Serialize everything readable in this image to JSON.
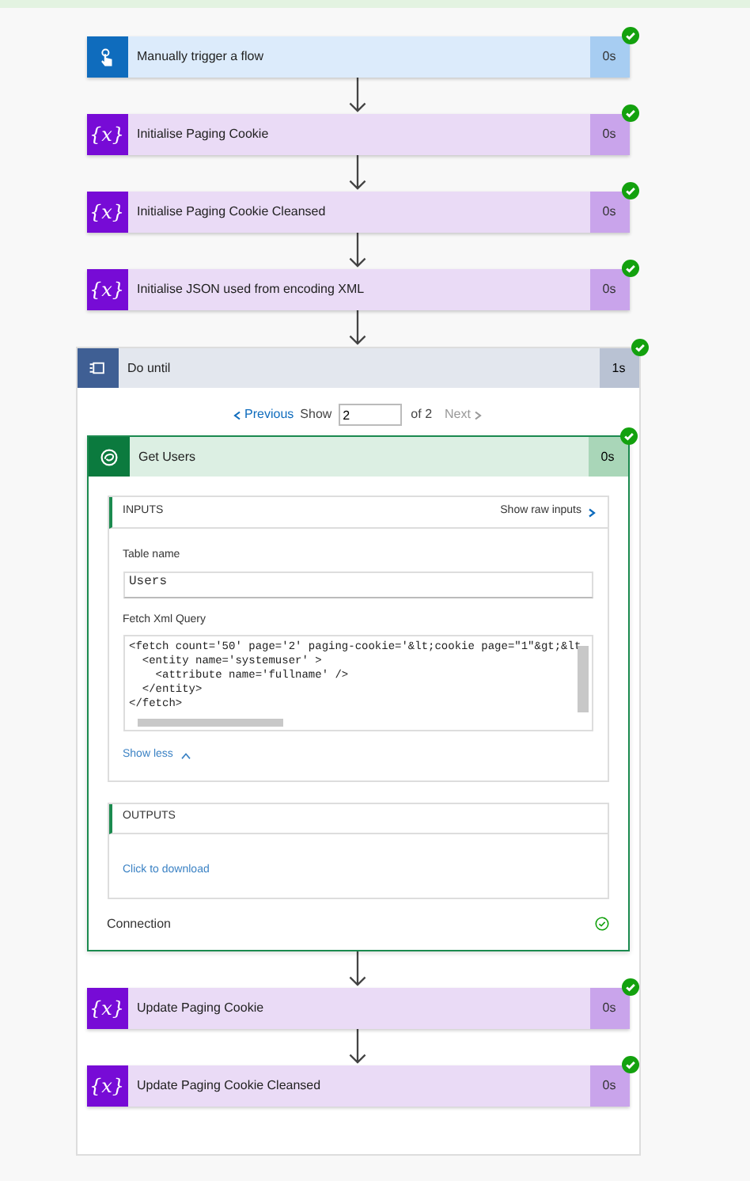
{
  "steps_before": [
    {
      "kind": "trigger",
      "title": "Manually trigger a flow",
      "duration": "0s",
      "succeeded": true
    },
    {
      "kind": "variable",
      "glyph": "{x}",
      "title": "Initialise Paging Cookie",
      "duration": "0s",
      "succeeded": true
    },
    {
      "kind": "variable",
      "glyph": "{x}",
      "title": "Initialise Paging Cookie Cleansed",
      "duration": "0s",
      "succeeded": true
    },
    {
      "kind": "variable",
      "glyph": "{x}",
      "title": "Initialise JSON used from encoding XML",
      "duration": "0s",
      "succeeded": true
    }
  ],
  "loop": {
    "title": "Do until",
    "duration": "1s",
    "succeeded": true,
    "pager": {
      "previous": "Previous",
      "previous_disabled": false,
      "show": "Show",
      "value": "2",
      "of": "of 2",
      "next": "Next",
      "next_disabled": true
    },
    "action": {
      "title": "Get Users",
      "duration": "0s",
      "succeeded": true,
      "inputs": {
        "heading": "INPUTS",
        "raw_link": "Show raw inputs",
        "fields": [
          {
            "label": "Table name",
            "value": "Users"
          }
        ],
        "query": {
          "label": "Fetch Xml Query",
          "lines": [
            "<fetch count='50' page='2' paging-cookie='&lt;cookie page=\"1\"&gt;&lt",
            "  <entity name='systemuser' >",
            "    <attribute name='fullname' />",
            "  </entity>",
            "</fetch>"
          ]
        },
        "show_less": "Show less"
      },
      "outputs": {
        "heading": "OUTPUTS",
        "link": "Click to download"
      },
      "connection": {
        "label": "Connection",
        "ok": true
      }
    },
    "steps_after": [
      {
        "kind": "variable",
        "glyph": "{x}",
        "title": "Update Paging Cookie",
        "duration": "0s",
        "succeeded": true
      },
      {
        "kind": "variable",
        "glyph": "{x}",
        "title": "Update Paging Cookie Cleansed",
        "duration": "0s",
        "succeeded": true
      }
    ]
  }
}
